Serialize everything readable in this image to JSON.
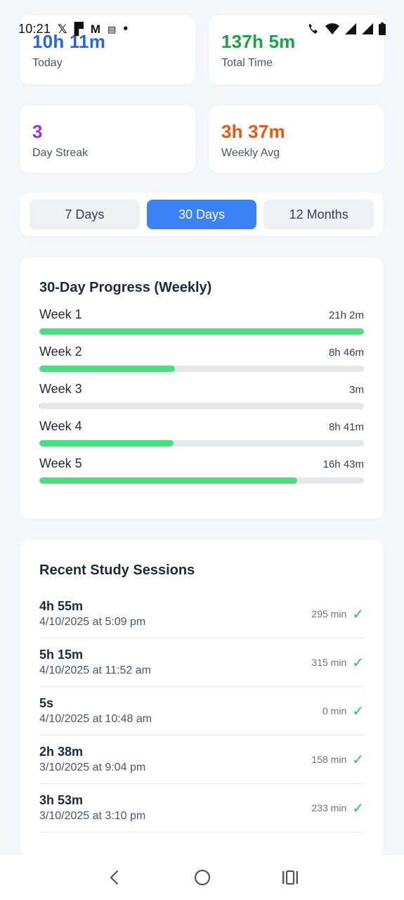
{
  "status_bar": {
    "time": "10:21",
    "icons": [
      "x-icon",
      "bag-icon",
      "gmail-icon",
      "doc-icon",
      "dot-icon",
      "wifi-call-icon",
      "wifi-icon",
      "signal-icon",
      "signal-icon",
      "battery-icon"
    ]
  },
  "stats": {
    "today": {
      "value": "10h 11m",
      "label": "Today",
      "color": "#2563eb"
    },
    "total": {
      "value": "137h 5m",
      "label": "Total Time",
      "color": "#16a34a"
    },
    "streak": {
      "value": "3",
      "label": "Day Streak",
      "color": "#9333ea"
    },
    "weekly_avg": {
      "value": "3h 37m",
      "label": "Weekly Avg",
      "color": "#ea580c"
    }
  },
  "tabs": [
    {
      "label": "7 Days",
      "active": false
    },
    {
      "label": "30 Days",
      "active": true
    },
    {
      "label": "12 Months",
      "active": false
    }
  ],
  "progress": {
    "title": "30-Day Progress (Weekly)",
    "weeks": [
      {
        "name": "Week 1",
        "time": "21h 2m",
        "fraction": 1.0
      },
      {
        "name": "Week 2",
        "time": "8h 46m",
        "fraction": 0.417
      },
      {
        "name": "Week 3",
        "time": "3m",
        "fraction": 0.002
      },
      {
        "name": "Week 4",
        "time": "8h 41m",
        "fraction": 0.413
      },
      {
        "name": "Week 5",
        "time": "16h 43m",
        "fraction": 0.795
      }
    ]
  },
  "sessions": {
    "title": "Recent Study Sessions",
    "items": [
      {
        "duration": "4h 55m",
        "date": "4/10/2025 at 5:09 pm",
        "minutes": "295 min"
      },
      {
        "duration": "5h 15m",
        "date": "4/10/2025 at 11:52 am",
        "minutes": "315 min"
      },
      {
        "duration": "5s",
        "date": "4/10/2025 at 10:48 am",
        "minutes": "0 min"
      },
      {
        "duration": "2h 38m",
        "date": "3/10/2025 at 9:04 pm",
        "minutes": "158 min"
      },
      {
        "duration": "3h 53m",
        "date": "3/10/2025 at 3:10 pm",
        "minutes": "233 min"
      }
    ]
  },
  "nav": [
    "back-icon",
    "home-icon",
    "recents-icon"
  ]
}
